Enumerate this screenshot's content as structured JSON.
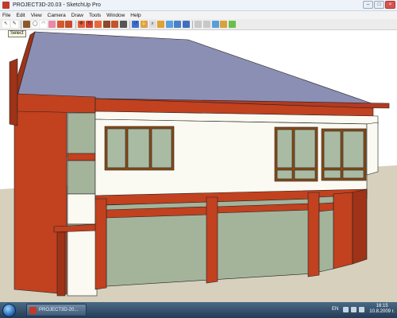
{
  "window": {
    "title": "PROJECT3D-20.03 - SketchUp Pro",
    "buttons": {
      "minimize": "–",
      "maximize": "□",
      "close": "×"
    }
  },
  "menu": [
    "File",
    "Edit",
    "View",
    "Camera",
    "Draw",
    "Tools",
    "Window",
    "Help"
  ],
  "toolbar": {
    "tools": [
      {
        "name": "select-icon",
        "glyph": "↖",
        "color": "#ffffff"
      },
      {
        "name": "pencil-icon",
        "glyph": "✎",
        "color": "#ffffff"
      },
      {
        "name": "rectangle-icon",
        "glyph": "",
        "color": "#8b5a2b"
      },
      {
        "name": "circle-icon",
        "glyph": "◯",
        "color": "#ffffff"
      },
      {
        "name": "arc-icon",
        "glyph": "◠",
        "color": "#ffffff"
      },
      {
        "name": "eraser-icon",
        "glyph": "",
        "color": "#e88aa8"
      },
      {
        "name": "paint-bucket-icon",
        "glyph": "",
        "color": "#d55a2b"
      },
      {
        "name": "push-pull-icon",
        "glyph": "",
        "color": "#c44d2a"
      },
      {
        "name": "move-icon",
        "glyph": "✥",
        "color": "#e35a35"
      },
      {
        "name": "rotate-icon",
        "glyph": "↻",
        "color": "#d43f2f"
      },
      {
        "name": "follow-me-icon",
        "glyph": "",
        "color": "#e76a3a"
      },
      {
        "name": "scale-icon",
        "glyph": "",
        "color": "#8a4a2b"
      },
      {
        "name": "offset-icon",
        "glyph": "",
        "color": "#c2552c"
      },
      {
        "name": "tape-measure-icon",
        "glyph": "",
        "color": "#555555"
      },
      {
        "name": "orbit-icon",
        "glyph": "↺",
        "color": "#3a6fd0"
      },
      {
        "name": "pan-icon",
        "glyph": "✋",
        "color": "#d7a05a"
      },
      {
        "name": "zoom-icon",
        "glyph": "⌕",
        "color": "#dddddd"
      },
      {
        "name": "zoom-extents-icon",
        "glyph": "",
        "color": "#e0a235"
      },
      {
        "name": "previous-view-icon",
        "glyph": "",
        "color": "#5aa0e0"
      },
      {
        "name": "next-view-icon",
        "glyph": "",
        "color": "#4a80c8"
      },
      {
        "name": "iso-view-icon",
        "glyph": "",
        "color": "#3f6fbf"
      },
      {
        "name": "top-view-icon",
        "glyph": "",
        "color": "#c8c8c8"
      },
      {
        "name": "front-view-icon",
        "glyph": "",
        "color": "#c8c8c8"
      },
      {
        "name": "get-models-icon",
        "glyph": "",
        "color": "#5a9ed6"
      },
      {
        "name": "share-model-icon",
        "glyph": "",
        "color": "#d8a23a"
      },
      {
        "name": "components-icon",
        "glyph": "",
        "color": "#6abf4b"
      }
    ],
    "separators_after": [
      1,
      7,
      13,
      20
    ]
  },
  "tooltip": "Select",
  "scene": {
    "sky": "#ffffff",
    "ground": "#d6d0bd",
    "roof": "#8c8fb4",
    "roof_edge": "#7d7fa4",
    "fascia": "#b33a22",
    "wall_red": "#c2411f",
    "wall_red_dark": "#9e3317",
    "wall_cream": "#fbfaf2",
    "wall_green": "#a3b49b",
    "window_frame": "#8b4a16",
    "glass": "#a9bba3"
  },
  "taskbar": {
    "task_label": "PROJECT3D-20...",
    "language": "EN",
    "time": "16:15",
    "date": "10.8.2009 r."
  }
}
